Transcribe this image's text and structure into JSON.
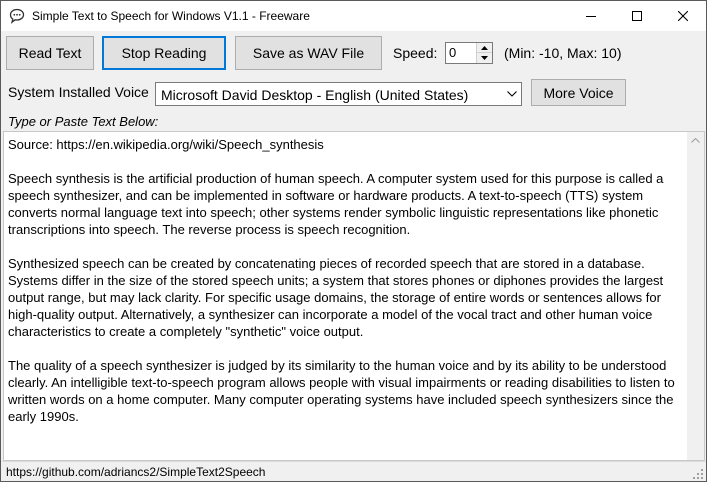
{
  "window": {
    "title": "Simple Text to Speech for Windows V1.1 - Freeware",
    "app_icon": "speech-bubble-icon",
    "controls": [
      "minimize-icon",
      "maximize-icon",
      "close-icon"
    ]
  },
  "toolbar": {
    "read_label": "Read Text",
    "stop_label": "Stop Reading",
    "save_label": "Save as WAV File",
    "speed_label": "Speed:",
    "speed_value": "0",
    "speed_range": "(Min: -10, Max: 10)"
  },
  "voice": {
    "label": "System Installed Voice",
    "selected": "Microsoft David Desktop - English (United States)",
    "more_label": "More Voice"
  },
  "editor": {
    "hint": "Type or Paste Text Below:",
    "paragraphs": [
      "Source: https://en.wikipedia.org/wiki/Speech_synthesis",
      "Speech synthesis is the artificial production of human speech. A computer system used for this purpose is called a speech synthesizer, and can be implemented in software or hardware products. A text-to-speech (TTS) system converts normal language text into speech; other systems render symbolic linguistic representations like phonetic transcriptions into speech. The reverse process is speech recognition.",
      "Synthesized speech can be created by concatenating pieces of recorded speech that are stored in a database. Systems differ in the size of the stored speech units; a system that stores phones or diphones provides the largest output range, but may lack clarity. For specific usage domains, the storage of entire words or sentences allows for high-quality output. Alternatively, a synthesizer can incorporate a model of the vocal tract and other human voice characteristics to create a completely \"synthetic\" voice output.",
      "The quality of a speech synthesizer is judged by its similarity to the human voice and by its ability to be understood clearly. An intelligible text-to-speech program allows people with visual impairments or reading disabilities to listen to written words on a home computer. Many computer operating systems have included speech synthesizers since the early 1990s."
    ]
  },
  "status": {
    "text": "https://github.com/adriancs2/SimpleText2Speech"
  },
  "colors": {
    "focus_border": "#0078d7",
    "button_face": "#e1e1e1",
    "window_bg": "#f0f0f0"
  }
}
